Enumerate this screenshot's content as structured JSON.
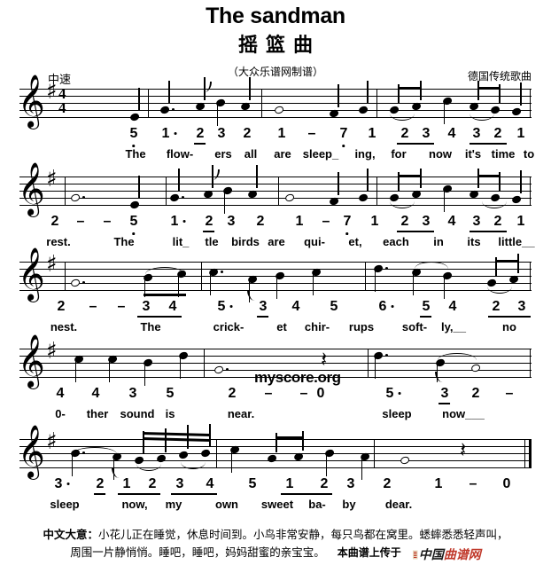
{
  "header": {
    "title_en": "The sandman",
    "title_cn": "摇篮曲",
    "subtitle_cn": "（大众乐谱网制谱）",
    "tempo": "中速",
    "composer": "德国传统歌曲"
  },
  "score": {
    "clef": "𝄞",
    "key_signature": "♯",
    "time_signature": {
      "numerator": "4",
      "denominator": "4"
    },
    "rest_glyph": "𝄽",
    "systems": [
      {
        "id": "system-1",
        "numbers": [
          "5",
          "1",
          "2",
          "3",
          "2",
          "1",
          "–",
          "7",
          "1",
          "2",
          "3",
          "4",
          "3",
          "2",
          "1"
        ],
        "lyrics": [
          "The",
          "flow-",
          "ers",
          "all",
          "are",
          "sleep_",
          "ing,",
          "for",
          "now",
          "it's",
          "time",
          "to"
        ]
      },
      {
        "id": "system-2",
        "numbers": [
          "2",
          "–",
          "–",
          "5",
          "1",
          "2",
          "3",
          "2",
          "1",
          "–",
          "7",
          "1",
          "2",
          "3",
          "4",
          "3",
          "2",
          "1"
        ],
        "lyrics": [
          "rest.",
          "The",
          "lit_",
          "tle",
          "birds",
          "are",
          "qui-",
          "et,",
          "each",
          "in",
          "its",
          "little__"
        ]
      },
      {
        "id": "system-3",
        "numbers": [
          "2",
          "–",
          "–",
          "3",
          "4",
          "5",
          "3",
          "4",
          "5",
          "6",
          "5",
          "4",
          "2",
          "3"
        ],
        "lyrics": [
          "nest.",
          "The",
          "crick-",
          "et",
          "chir-",
          "rups",
          "soft-",
          "ly,__",
          "no"
        ]
      },
      {
        "id": "system-4",
        "numbers": [
          "4",
          "4",
          "3",
          "5",
          "2",
          "–",
          "–",
          "0",
          "5",
          "3",
          "2",
          "–"
        ],
        "lyrics": [
          "0-",
          "ther",
          "sound",
          "is",
          "near.",
          "sleep",
          "now___"
        ]
      },
      {
        "id": "system-5",
        "numbers": [
          "3",
          "2",
          "1",
          "2",
          "3",
          "4",
          "5",
          "1",
          "2",
          "3",
          "2",
          "1",
          "–",
          "0"
        ],
        "lyrics": [
          "sleep",
          "now,",
          "my",
          "own",
          "sweet",
          "ba-",
          "by",
          "dear."
        ]
      }
    ]
  },
  "watermark": "myscore.org",
  "footer": {
    "label": "中文大意：",
    "line1": "小花儿正在睡觉，休息时间到。小鸟非常安静，每只鸟都在窝里。蟋蟀悉悉轻声叫，",
    "line2": "周围一片静悄悄。睡吧，睡吧，妈妈甜蜜的亲宝宝。",
    "credit": "本曲谱上传于",
    "logo_text_black": "中国",
    "logo_text_red": "曲谱网"
  }
}
